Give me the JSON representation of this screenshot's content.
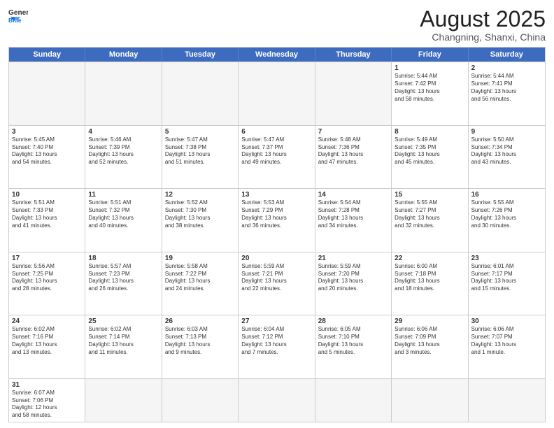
{
  "header": {
    "logo_general": "General",
    "logo_blue": "Blue",
    "month_title": "August 2025",
    "subtitle": "Changning, Shanxi, China"
  },
  "days_of_week": [
    "Sunday",
    "Monday",
    "Tuesday",
    "Wednesday",
    "Thursday",
    "Friday",
    "Saturday"
  ],
  "weeks": [
    [
      {
        "day": "",
        "info": ""
      },
      {
        "day": "",
        "info": ""
      },
      {
        "day": "",
        "info": ""
      },
      {
        "day": "",
        "info": ""
      },
      {
        "day": "",
        "info": ""
      },
      {
        "day": "1",
        "info": "Sunrise: 5:44 AM\nSunset: 7:42 PM\nDaylight: 13 hours\nand 58 minutes."
      },
      {
        "day": "2",
        "info": "Sunrise: 5:44 AM\nSunset: 7:41 PM\nDaylight: 13 hours\nand 56 minutes."
      }
    ],
    [
      {
        "day": "3",
        "info": "Sunrise: 5:45 AM\nSunset: 7:40 PM\nDaylight: 13 hours\nand 54 minutes."
      },
      {
        "day": "4",
        "info": "Sunrise: 5:46 AM\nSunset: 7:39 PM\nDaylight: 13 hours\nand 52 minutes."
      },
      {
        "day": "5",
        "info": "Sunrise: 5:47 AM\nSunset: 7:38 PM\nDaylight: 13 hours\nand 51 minutes."
      },
      {
        "day": "6",
        "info": "Sunrise: 5:47 AM\nSunset: 7:37 PM\nDaylight: 13 hours\nand 49 minutes."
      },
      {
        "day": "7",
        "info": "Sunrise: 5:48 AM\nSunset: 7:36 PM\nDaylight: 13 hours\nand 47 minutes."
      },
      {
        "day": "8",
        "info": "Sunrise: 5:49 AM\nSunset: 7:35 PM\nDaylight: 13 hours\nand 45 minutes."
      },
      {
        "day": "9",
        "info": "Sunrise: 5:50 AM\nSunset: 7:34 PM\nDaylight: 13 hours\nand 43 minutes."
      }
    ],
    [
      {
        "day": "10",
        "info": "Sunrise: 5:51 AM\nSunset: 7:33 PM\nDaylight: 13 hours\nand 41 minutes."
      },
      {
        "day": "11",
        "info": "Sunrise: 5:51 AM\nSunset: 7:32 PM\nDaylight: 13 hours\nand 40 minutes."
      },
      {
        "day": "12",
        "info": "Sunrise: 5:52 AM\nSunset: 7:30 PM\nDaylight: 13 hours\nand 38 minutes."
      },
      {
        "day": "13",
        "info": "Sunrise: 5:53 AM\nSunset: 7:29 PM\nDaylight: 13 hours\nand 36 minutes."
      },
      {
        "day": "14",
        "info": "Sunrise: 5:54 AM\nSunset: 7:28 PM\nDaylight: 13 hours\nand 34 minutes."
      },
      {
        "day": "15",
        "info": "Sunrise: 5:55 AM\nSunset: 7:27 PM\nDaylight: 13 hours\nand 32 minutes."
      },
      {
        "day": "16",
        "info": "Sunrise: 5:55 AM\nSunset: 7:26 PM\nDaylight: 13 hours\nand 30 minutes."
      }
    ],
    [
      {
        "day": "17",
        "info": "Sunrise: 5:56 AM\nSunset: 7:25 PM\nDaylight: 13 hours\nand 28 minutes."
      },
      {
        "day": "18",
        "info": "Sunrise: 5:57 AM\nSunset: 7:23 PM\nDaylight: 13 hours\nand 26 minutes."
      },
      {
        "day": "19",
        "info": "Sunrise: 5:58 AM\nSunset: 7:22 PM\nDaylight: 13 hours\nand 24 minutes."
      },
      {
        "day": "20",
        "info": "Sunrise: 5:59 AM\nSunset: 7:21 PM\nDaylight: 13 hours\nand 22 minutes."
      },
      {
        "day": "21",
        "info": "Sunrise: 5:59 AM\nSunset: 7:20 PM\nDaylight: 13 hours\nand 20 minutes."
      },
      {
        "day": "22",
        "info": "Sunrise: 6:00 AM\nSunset: 7:18 PM\nDaylight: 13 hours\nand 18 minutes."
      },
      {
        "day": "23",
        "info": "Sunrise: 6:01 AM\nSunset: 7:17 PM\nDaylight: 13 hours\nand 15 minutes."
      }
    ],
    [
      {
        "day": "24",
        "info": "Sunrise: 6:02 AM\nSunset: 7:16 PM\nDaylight: 13 hours\nand 13 minutes."
      },
      {
        "day": "25",
        "info": "Sunrise: 6:02 AM\nSunset: 7:14 PM\nDaylight: 13 hours\nand 11 minutes."
      },
      {
        "day": "26",
        "info": "Sunrise: 6:03 AM\nSunset: 7:13 PM\nDaylight: 13 hours\nand 9 minutes."
      },
      {
        "day": "27",
        "info": "Sunrise: 6:04 AM\nSunset: 7:12 PM\nDaylight: 13 hours\nand 7 minutes."
      },
      {
        "day": "28",
        "info": "Sunrise: 6:05 AM\nSunset: 7:10 PM\nDaylight: 13 hours\nand 5 minutes."
      },
      {
        "day": "29",
        "info": "Sunrise: 6:06 AM\nSunset: 7:09 PM\nDaylight: 13 hours\nand 3 minutes."
      },
      {
        "day": "30",
        "info": "Sunrise: 6:06 AM\nSunset: 7:07 PM\nDaylight: 13 hours\nand 1 minute."
      }
    ],
    [
      {
        "day": "31",
        "info": "Sunrise: 6:07 AM\nSunset: 7:06 PM\nDaylight: 12 hours\nand 58 minutes."
      },
      {
        "day": "",
        "info": ""
      },
      {
        "day": "",
        "info": ""
      },
      {
        "day": "",
        "info": ""
      },
      {
        "day": "",
        "info": ""
      },
      {
        "day": "",
        "info": ""
      },
      {
        "day": "",
        "info": ""
      }
    ]
  ]
}
